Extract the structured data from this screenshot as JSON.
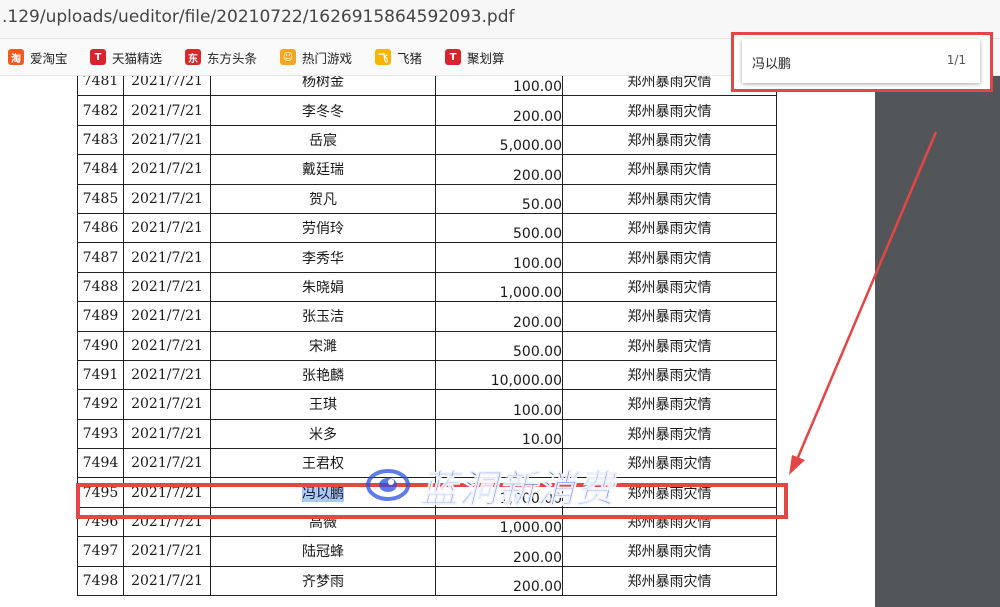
{
  "browser": {
    "url": ".129/uploads/ueditor/file/20210722/1626915864592093.pdf"
  },
  "bookmarks": [
    {
      "label": "爱淘宝",
      "icon": "taobao-icon",
      "glyph": "淘",
      "color": "#f25a1e"
    },
    {
      "label": "天猫精选",
      "icon": "tmall-icon",
      "glyph": "T",
      "color": "#d9232e"
    },
    {
      "label": "东方头条",
      "icon": "dftt-icon",
      "glyph": "东",
      "color": "#d62a2a"
    },
    {
      "label": "热门游戏",
      "icon": "game-icon",
      "glyph": "☺",
      "color": "#f5a623"
    },
    {
      "label": "飞猪",
      "icon": "fliggy-icon",
      "glyph": "飞",
      "color": "#f7b500"
    },
    {
      "label": "聚划算",
      "icon": "juhuasuan-icon",
      "glyph": "T",
      "color": "#d9232e"
    }
  ],
  "find": {
    "query": "冯以鹏",
    "count": "1/1"
  },
  "table": {
    "rows": [
      {
        "no": "7481",
        "date": "2021/7/21",
        "name": "杨树金",
        "amount": "100.00",
        "note": "郑州暴雨灾情"
      },
      {
        "no": "7482",
        "date": "2021/7/21",
        "name": "李冬冬",
        "amount": "200.00",
        "note": "郑州暴雨灾情"
      },
      {
        "no": "7483",
        "date": "2021/7/21",
        "name": "岳宸",
        "amount": "5,000.00",
        "note": "郑州暴雨灾情"
      },
      {
        "no": "7484",
        "date": "2021/7/21",
        "name": "戴廷瑞",
        "amount": "200.00",
        "note": "郑州暴雨灾情"
      },
      {
        "no": "7485",
        "date": "2021/7/21",
        "name": "贺凡",
        "amount": "50.00",
        "note": "郑州暴雨灾情"
      },
      {
        "no": "7486",
        "date": "2021/7/21",
        "name": "劳俏玲",
        "amount": "500.00",
        "note": "郑州暴雨灾情"
      },
      {
        "no": "7487",
        "date": "2021/7/21",
        "name": "李秀华",
        "amount": "100.00",
        "note": "郑州暴雨灾情"
      },
      {
        "no": "7488",
        "date": "2021/7/21",
        "name": "朱晓娟",
        "amount": "1,000.00",
        "note": "郑州暴雨灾情"
      },
      {
        "no": "7489",
        "date": "2021/7/21",
        "name": "张玉洁",
        "amount": "200.00",
        "note": "郑州暴雨灾情"
      },
      {
        "no": "7490",
        "date": "2021/7/21",
        "name": "宋濉",
        "amount": "500.00",
        "note": "郑州暴雨灾情"
      },
      {
        "no": "7491",
        "date": "2021/7/21",
        "name": "张艳麟",
        "amount": "10,000.00",
        "note": "郑州暴雨灾情"
      },
      {
        "no": "7492",
        "date": "2021/7/21",
        "name": "王琪",
        "amount": "100.00",
        "note": "郑州暴雨灾情"
      },
      {
        "no": "7493",
        "date": "2021/7/21",
        "name": "米多",
        "amount": "10.00",
        "note": "郑州暴雨灾情"
      },
      {
        "no": "7494",
        "date": "2021/7/21",
        "name": "王君权",
        "amount": "",
        "note": "郑州暴雨灾情"
      },
      {
        "no": "7495",
        "date": "2021/7/21",
        "name": "冯以鹏",
        "amount": "1,000.00",
        "note": "郑州暴雨灾情"
      },
      {
        "no": "7496",
        "date": "2021/7/21",
        "name": "高薇",
        "amount": "1,000.00",
        "note": "郑州暴雨灾情"
      },
      {
        "no": "7497",
        "date": "2021/7/21",
        "name": "陆冠蜂",
        "amount": "200.00",
        "note": "郑州暴雨灾情"
      },
      {
        "no": "7498",
        "date": "2021/7/21",
        "name": "齐梦雨",
        "amount": "200.00",
        "note": "郑州暴雨灾情"
      }
    ]
  },
  "watermark": {
    "text": "蓝洞新消费"
  },
  "colors": {
    "annotation": "#e64545",
    "viewer_bg": "#525659",
    "highlight": "#a9c8ff"
  }
}
